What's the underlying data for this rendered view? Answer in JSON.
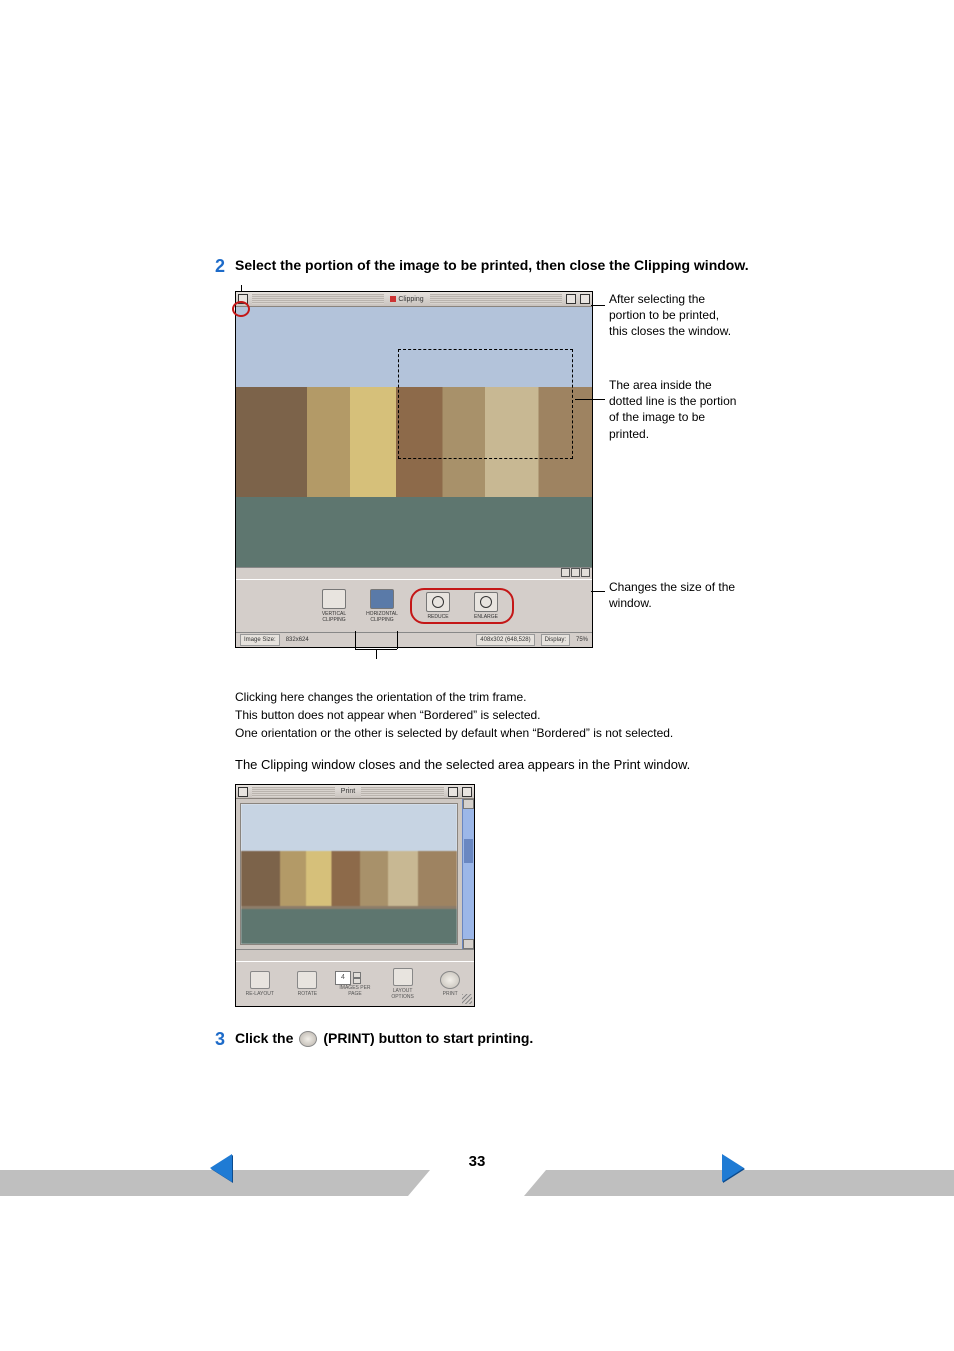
{
  "step2": {
    "number": "2",
    "title": "Select the portion of the image to be printed, then close the Clipping window."
  },
  "clipping": {
    "title": "Clipping",
    "toolbar": {
      "vertical": "VERTICAL CLIPPING",
      "horizontal": "HORIZONTAL CLIPPING",
      "reduce": "REDUCE",
      "enlarge": "ENLARGE"
    },
    "status": {
      "label": "Image Size:",
      "value": "832x624",
      "crop": "408x302 (648,528)",
      "disp_label": "Display:",
      "disp_value": "75%"
    }
  },
  "callouts": {
    "close": "After selecting the portion to be printed, this closes the window.",
    "area": "The area inside the dotted line is the portion of the image to be printed.",
    "resize": "Changes the size of the window.",
    "bottom1": "Clicking here changes the orientation of the trim frame.",
    "bottom2": "This button does not appear when “Bordered” is selected.",
    "bottom3": "One orientation or the other is selected by default when “Bordered” is not selected."
  },
  "after_text": "The Clipping window closes and the selected area appears in the Print window.",
  "print_window": {
    "title": "Print",
    "toolbar": {
      "relayout": "RE-LAYOUT",
      "rotate": "ROTATE",
      "ipp_value": "4",
      "ipp_label": "IMAGES PER PAGE",
      "layout": "LAYOUT OPTIONS",
      "print": "PRINT"
    }
  },
  "step3": {
    "number": "3",
    "prefix": "Click the",
    "suffix": "(PRINT) button to start printing."
  },
  "page_number": "33"
}
